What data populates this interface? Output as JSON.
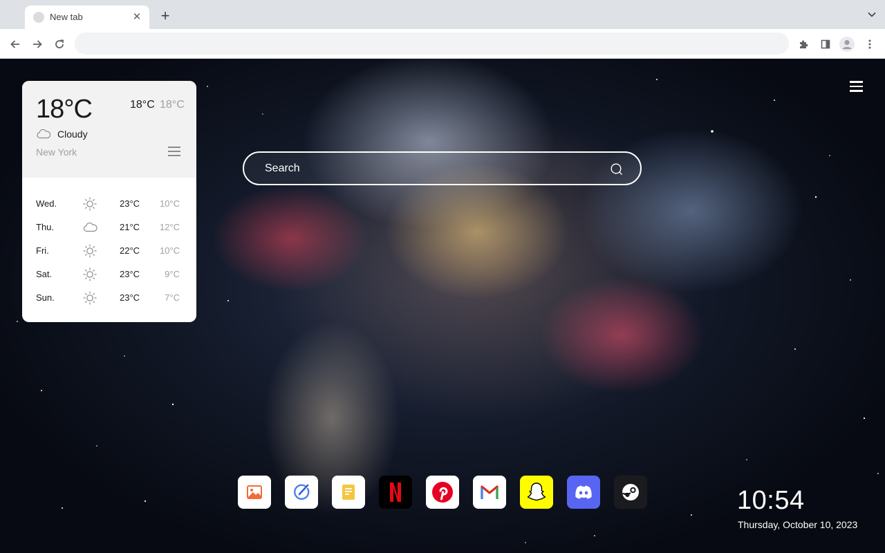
{
  "browser": {
    "tab_title": "New tab",
    "new_tab_symbol": "+",
    "close_symbol": "✕",
    "address_value": ""
  },
  "weather": {
    "current_temp": "18°C",
    "high": "18°C",
    "low": "18°C",
    "condition": "Cloudy",
    "condition_icon": "cloud-icon",
    "location": "New York",
    "forecast": [
      {
        "day": "Wed.",
        "icon": "sun-icon",
        "high": "23°C",
        "low": "10°C"
      },
      {
        "day": "Thu.",
        "icon": "cloud-icon",
        "high": "21°C",
        "low": "12°C"
      },
      {
        "day": "Fri.",
        "icon": "sun-icon",
        "high": "22°C",
        "low": "10°C"
      },
      {
        "day": "Sat.",
        "icon": "sun-icon",
        "high": "23°C",
        "low": "9°C"
      },
      {
        "day": "Sun.",
        "icon": "sun-icon",
        "high": "23°C",
        "low": "7°C"
      }
    ]
  },
  "search": {
    "placeholder": "Search"
  },
  "dock": [
    {
      "name": "gallery-app-icon",
      "bg": "#ffffff"
    },
    {
      "name": "edit-app-icon",
      "bg": "#ffffff"
    },
    {
      "name": "notes-app-icon",
      "bg": "#ffffff"
    },
    {
      "name": "netflix-icon",
      "bg": "#000000"
    },
    {
      "name": "pinterest-icon",
      "bg": "#ffffff"
    },
    {
      "name": "gmail-icon",
      "bg": "#ffffff"
    },
    {
      "name": "snapchat-icon",
      "bg": "#fffc00"
    },
    {
      "name": "discord-icon",
      "bg": "#5865f2"
    },
    {
      "name": "steam-icon",
      "bg": "#1b1b1f"
    }
  ],
  "clock": {
    "time": "10:54",
    "date": "Thursday, October 10, 2023"
  }
}
